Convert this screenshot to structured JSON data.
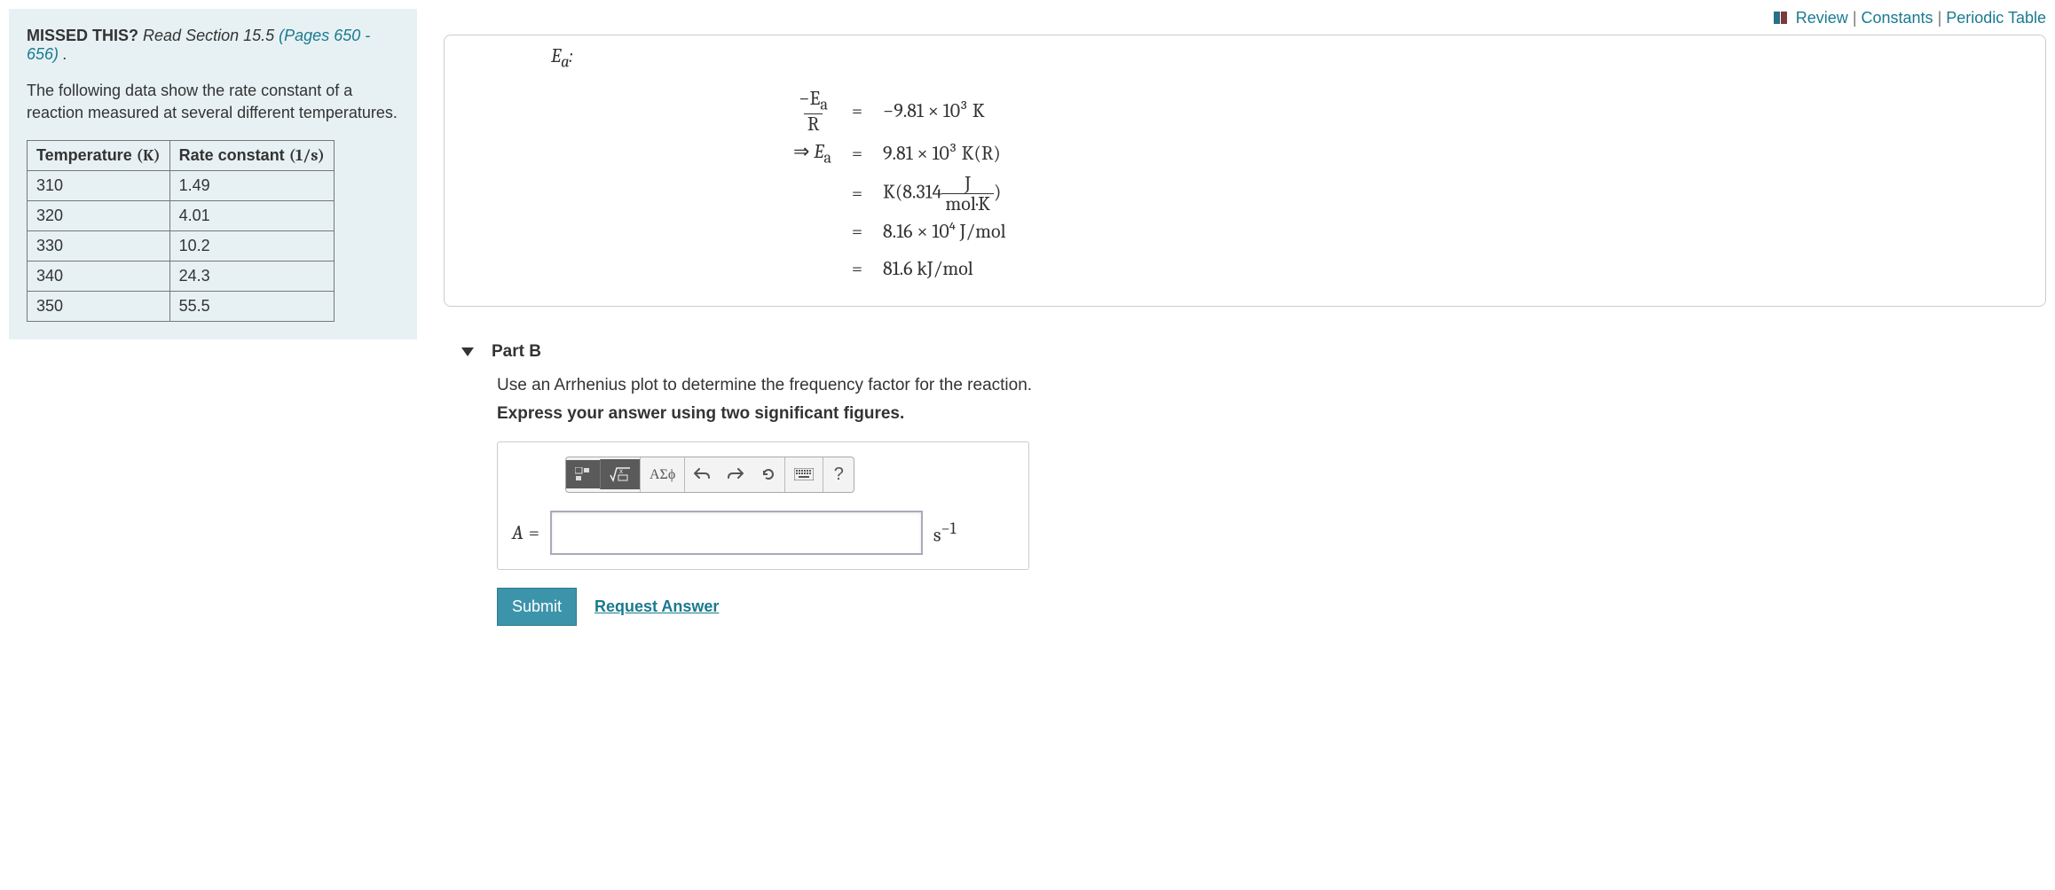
{
  "toplinks": {
    "review": "Review",
    "constants": "Constants",
    "periodic": "Periodic Table"
  },
  "sidebar": {
    "missed_label": "MISSED THIS?",
    "read": "Read Section 15.5",
    "pages": "(Pages 650 - 656)",
    "period": " .",
    "problem": "The following data show the rate constant of a reaction measured at several different temperatures.",
    "table": {
      "headers": {
        "temp": "Temperature",
        "rate": "Rate constant"
      },
      "units": {
        "temp": "(K)",
        "rate": "(1/s)"
      },
      "rows": [
        {
          "t": "310",
          "k": "1.49"
        },
        {
          "t": "320",
          "k": "4.01"
        },
        {
          "t": "330",
          "k": "10.2"
        },
        {
          "t": "340",
          "k": "24.3"
        },
        {
          "t": "350",
          "k": "55.5"
        }
      ]
    }
  },
  "solution": {
    "header_sym": "E",
    "header_sub": "a",
    "header_colon": ":",
    "lines": {
      "l1_left_num": "−E",
      "l1_left_sub": "a",
      "l1_left_den": "R",
      "l1_right": "−9.81 × 10³ K",
      "l2_arrow": "⇒ ",
      "l2_E": "E",
      "l2_sub": "a",
      "l2_right": "9.81 × 10³ K(R)",
      "l3_right_pre": "K(8.314",
      "l3_frac_num": "J",
      "l3_frac_den": "mol·K",
      "l3_right_post": ")",
      "l4_right": "8.16 × 10⁴ J/mol",
      "l5_right": "81.6 kJ/mol"
    }
  },
  "partB": {
    "title": "Part B",
    "instr": "Use an Arrhenius plot to determine the frequency factor for the reaction.",
    "instr2": "Express your answer using two significant figures.",
    "toolbar": {
      "greek": "ΑΣϕ",
      "help": "?"
    },
    "label_A": "A",
    "label_eq": "=",
    "unit_s": "s",
    "unit_exp": "−1",
    "input_value": "",
    "submit": "Submit",
    "request": "Request Answer"
  }
}
